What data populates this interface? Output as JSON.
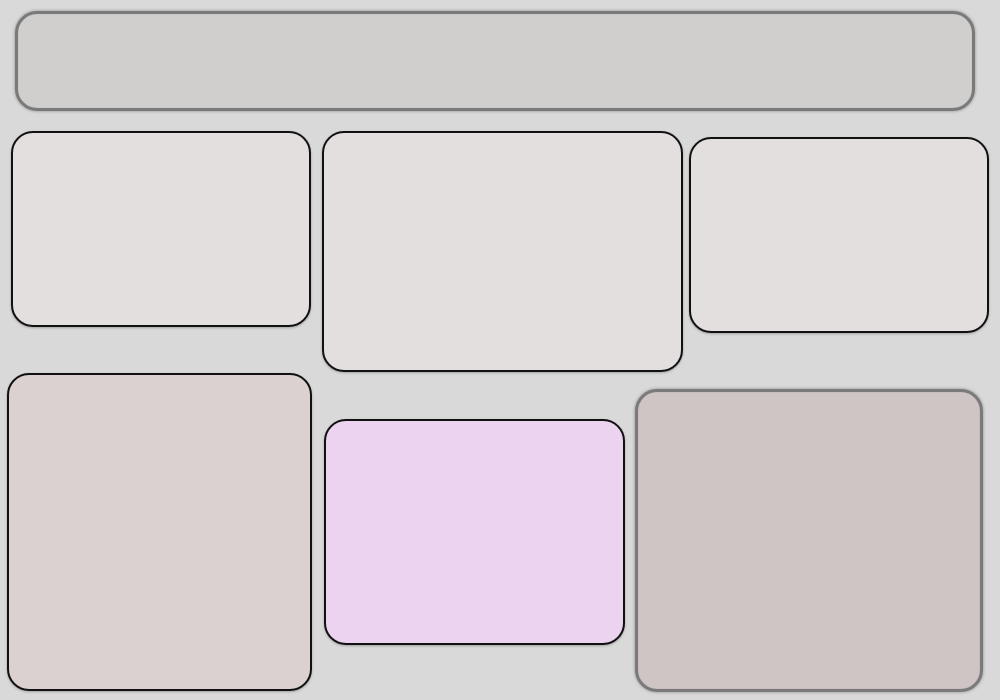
{
  "colors": {
    "background": "#d9d9d9",
    "header_bar": "#d1cece",
    "panel_light": "#e4dfdf",
    "panel_bottom_left": "#dbd1d0",
    "panel_accent_lilac": "#ecd3ef",
    "panel_bottom_right": "#cfc5c4",
    "border_dark": "#111111",
    "border_soft": "#7a7a7a"
  },
  "panels": [
    {
      "id": "header-bar"
    },
    {
      "id": "panel-top-left"
    },
    {
      "id": "panel-top-center"
    },
    {
      "id": "panel-top-right"
    },
    {
      "id": "panel-bottom-left"
    },
    {
      "id": "panel-bottom-center"
    },
    {
      "id": "panel-bottom-right"
    }
  ]
}
